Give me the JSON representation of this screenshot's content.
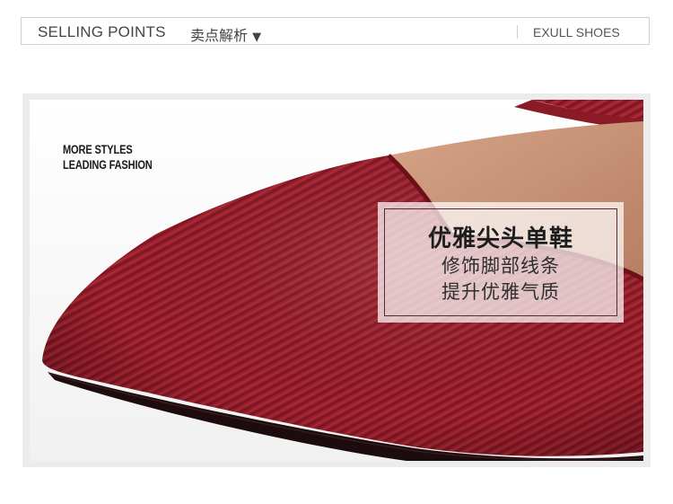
{
  "header": {
    "title": "SELLING POINTS",
    "subtitle": "卖点解析",
    "subtitle_arrow": "▼",
    "brand": "EXULL SHOES"
  },
  "banner": {
    "tagline": [
      "MORE STYLES",
      "LEADING FASHION"
    ],
    "caption_title": "优雅尖头单鞋",
    "caption_lines": [
      "修饰脚部线条",
      "提升优雅气质"
    ]
  },
  "colors": {
    "shoe_red": "#9b1f2c",
    "lining_tan": "#c89478",
    "caption_border": "#5a2a2e"
  }
}
